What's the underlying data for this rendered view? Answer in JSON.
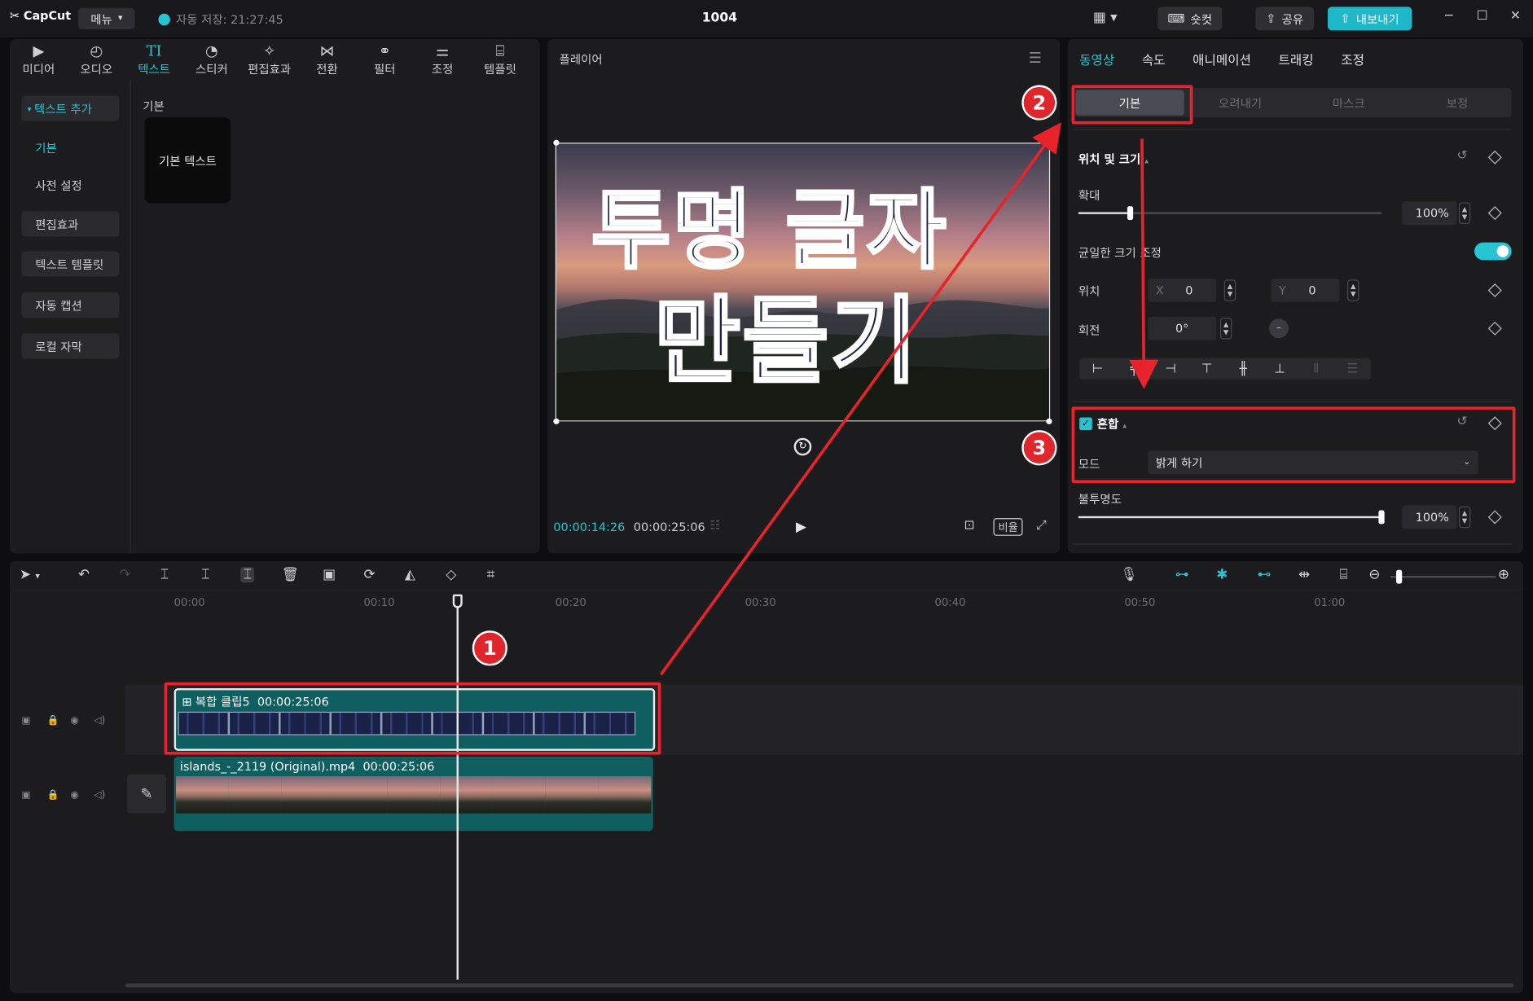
{
  "app": {
    "logo": "CapCut",
    "menu_label": "메뉴",
    "autosave": "자동 저장: 21:27:45",
    "project_title": "1004",
    "shortcut_label": "숏컷",
    "share_label": "공유",
    "export_label": "내보내기"
  },
  "toolbar": {
    "tools": [
      {
        "label": "미디어",
        "icon": "media-icon"
      },
      {
        "label": "오디오",
        "icon": "audio-icon"
      },
      {
        "label": "텍스트",
        "icon": "text-icon",
        "glyph": "TI"
      },
      {
        "label": "스티커",
        "icon": "sticker-icon"
      },
      {
        "label": "편집효과",
        "icon": "effects-icon"
      },
      {
        "label": "전환",
        "icon": "transition-icon"
      },
      {
        "label": "필터",
        "icon": "filter-icon"
      },
      {
        "label": "조정",
        "icon": "adjust-icon"
      },
      {
        "label": "템플릿",
        "icon": "template-icon"
      }
    ]
  },
  "text_panel": {
    "nav": [
      "텍스트 추가",
      "기본",
      "사전 설정",
      "편집효과",
      "텍스트 템플릿",
      "자동 캡션",
      "로컬 자막"
    ],
    "section_label": "기본",
    "card_label": "기본 텍스트"
  },
  "player": {
    "title": "플레이어",
    "preview_text_line1": "투명 글자",
    "preview_text_line2": "만들기",
    "current_time": "00:00:14:26",
    "total_time": "00:00:25:06",
    "ratio_label": "비율"
  },
  "inspector": {
    "tabs": [
      "동영상",
      "속도",
      "애니메이션",
      "트래킹",
      "조정"
    ],
    "subtabs": [
      "기본",
      "오려내기",
      "마스크",
      "보정"
    ],
    "pos_size_title": "위치 및 크기",
    "scale_label": "확대",
    "scale_value": "100%",
    "scale_fraction": 0.17,
    "uniform_label": "균일한 크기 조정",
    "position_label": "위치",
    "x_label": "X",
    "x_value": "0",
    "y_label": "Y",
    "y_value": "0",
    "rotation_label": "회전",
    "rotation_value": "0°",
    "blend_title": "혼합",
    "mode_label": "모드",
    "mode_value": "밝게 하기",
    "opacity_label": "불투명도",
    "opacity_value": "100%",
    "opacity_fraction": 1.0
  },
  "timeline": {
    "ruler": [
      "00:00",
      "00:10",
      "00:20",
      "00:30",
      "00:40",
      "00:50",
      "01:00"
    ],
    "compound_clip": {
      "name": "복합 클립5",
      "duration": "00:00:25:06"
    },
    "video_clip": {
      "name": "islands_-_2119 (Original).mp4",
      "duration": "00:00:25:06"
    }
  },
  "annotations": [
    "1",
    "2",
    "3"
  ],
  "colors": {
    "accent": "#27c4d4",
    "highlight": "#e8232c"
  }
}
